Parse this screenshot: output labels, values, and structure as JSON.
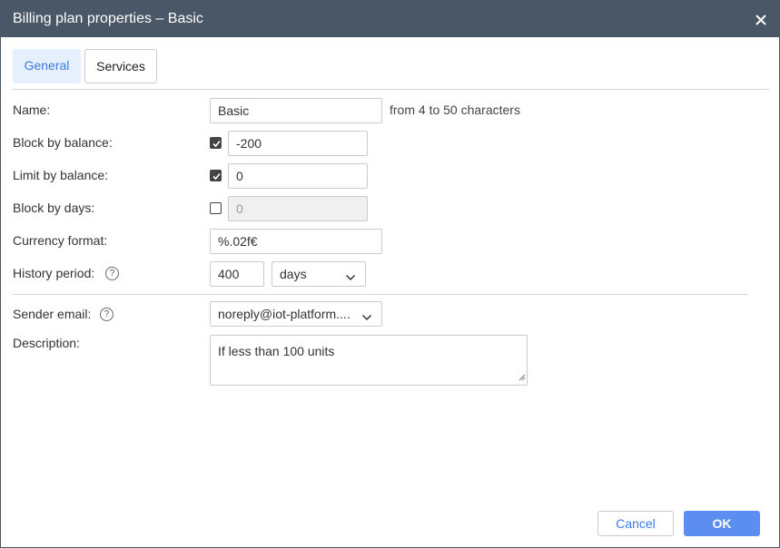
{
  "dialog": {
    "title": "Billing plan properties – Basic",
    "close_icon": "close-icon"
  },
  "tabs": [
    {
      "label": "General",
      "active": true
    },
    {
      "label": "Services",
      "active": false
    }
  ],
  "form": {
    "name": {
      "label": "Name:",
      "value": "Basic",
      "hint": "from 4 to 50 characters"
    },
    "block_by_balance": {
      "label": "Block by balance:",
      "checked": true,
      "value": "-200"
    },
    "limit_by_balance": {
      "label": "Limit by balance:",
      "checked": true,
      "value": "0"
    },
    "block_by_days": {
      "label": "Block by days:",
      "checked": false,
      "value": "0"
    },
    "currency_format": {
      "label": "Currency format:",
      "value": "%.02f€"
    },
    "history_period": {
      "label": "History period:",
      "value": "400",
      "unit": "days",
      "help_icon": "help-icon"
    },
    "sender_email": {
      "label": "Sender email:",
      "value": "noreply@iot-platform....",
      "help_icon": "help-icon"
    },
    "description": {
      "label": "Description:",
      "value": "If less than 100 units"
    }
  },
  "help_glyph": "?",
  "buttons": {
    "cancel": "Cancel",
    "ok": "OK"
  },
  "colors": {
    "titlebar": "#4a5766",
    "accent": "#3d7be8",
    "ok_button": "#5b8ef0",
    "active_tab_bg": "#e6effd"
  }
}
